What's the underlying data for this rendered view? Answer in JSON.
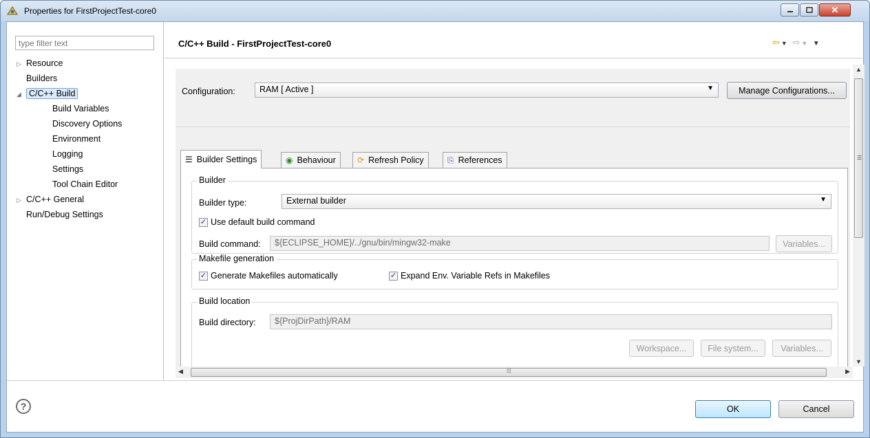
{
  "window": {
    "title": "Properties for FirstProjectTest-core0"
  },
  "filter": {
    "placeholder": "type filter text"
  },
  "tree": {
    "items": [
      {
        "label": "Resource",
        "arrow": "▷"
      },
      {
        "label": "Builders",
        "arrow": ""
      },
      {
        "label": "C/C++ Build",
        "arrow": "◢"
      },
      {
        "label": "Build Variables",
        "arrow": ""
      },
      {
        "label": "Discovery Options",
        "arrow": ""
      },
      {
        "label": "Environment",
        "arrow": ""
      },
      {
        "label": "Logging",
        "arrow": ""
      },
      {
        "label": "Settings",
        "arrow": ""
      },
      {
        "label": "Tool Chain Editor",
        "arrow": ""
      },
      {
        "label": "C/C++ General",
        "arrow": "▷"
      },
      {
        "label": "Run/Debug Settings",
        "arrow": ""
      }
    ]
  },
  "page": {
    "title": "C/C++ Build - FirstProjectTest-core0"
  },
  "configuration": {
    "label": "Configuration:",
    "value": "RAM  [ Active ]",
    "manage_button": "Manage Configurations..."
  },
  "tabs": [
    {
      "label": "Builder Settings",
      "icon": "list-icon"
    },
    {
      "label": "Behaviour",
      "icon": "radio-icon"
    },
    {
      "label": "Refresh Policy",
      "icon": "refresh-icon"
    },
    {
      "label": "References",
      "icon": "references-icon"
    }
  ],
  "builder": {
    "group_title": "Builder",
    "type_label": "Builder type:",
    "type_value": "External builder",
    "use_default_label": "Use default build command",
    "command_label": "Build command:",
    "command_value": "${ECLIPSE_HOME}/../gnu/bin/mingw32-make",
    "variables_button": "Variables..."
  },
  "makefile": {
    "group_title": "Makefile generation",
    "generate_label": "Generate Makefiles automatically",
    "expand_label": "Expand Env. Variable Refs in Makefiles"
  },
  "location": {
    "group_title": "Build location",
    "directory_label": "Build directory:",
    "directory_value": "${ProjDirPath}/RAM",
    "workspace_button": "Workspace...",
    "filesystem_button": "File system...",
    "variables_button": "Variables..."
  },
  "footer": {
    "ok": "OK",
    "cancel": "Cancel",
    "help": "?"
  }
}
